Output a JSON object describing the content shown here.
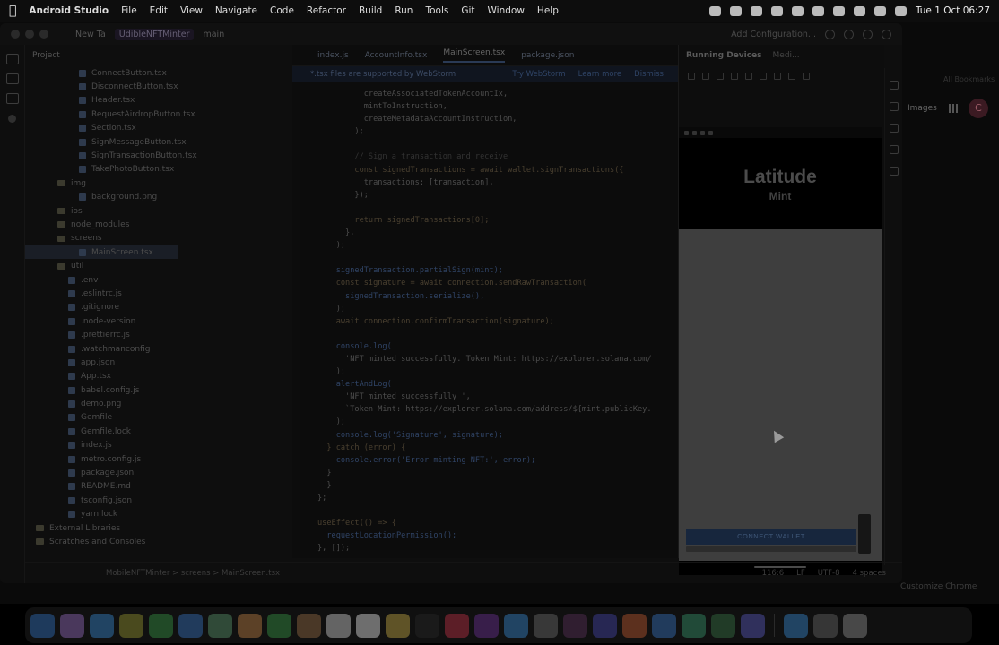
{
  "menubar": {
    "app_name": "Android Studio",
    "items": [
      "File",
      "Edit",
      "View",
      "Navigate",
      "Code",
      "Refactor",
      "Build",
      "Run",
      "Tools",
      "Git",
      "Window",
      "Help"
    ],
    "clock": "Tue 1 Oct 06:27"
  },
  "ide": {
    "top": {
      "new_tab": "New Ta",
      "project_name": "UdibleNFTMinter",
      "branch": "main",
      "run_config": "Add Configuration..."
    },
    "project_panel_title": "Project",
    "tree": [
      {
        "label": "ConnectButton.tsx",
        "kind": "file",
        "indent": 5
      },
      {
        "label": "DisconnectButton.tsx",
        "kind": "file",
        "indent": 5
      },
      {
        "label": "Header.tsx",
        "kind": "file",
        "indent": 5
      },
      {
        "label": "RequestAirdropButton.tsx",
        "kind": "file",
        "indent": 5
      },
      {
        "label": "Section.tsx",
        "kind": "file",
        "indent": 5
      },
      {
        "label": "SignMessageButton.tsx",
        "kind": "file",
        "indent": 5
      },
      {
        "label": "SignTransactionButton.tsx",
        "kind": "file",
        "indent": 5
      },
      {
        "label": "TakePhotoButton.tsx",
        "kind": "file",
        "indent": 5
      },
      {
        "label": "img",
        "kind": "dir",
        "indent": 3
      },
      {
        "label": "background.png",
        "kind": "file",
        "indent": 5
      },
      {
        "label": "ios",
        "kind": "dir",
        "indent": 3
      },
      {
        "label": "node_modules",
        "kind": "dir",
        "indent": 3
      },
      {
        "label": "screens",
        "kind": "dir",
        "indent": 3
      },
      {
        "label": "MainScreen.tsx",
        "kind": "file",
        "indent": 5,
        "selected": true
      },
      {
        "label": "util",
        "kind": "dir",
        "indent": 3
      },
      {
        "label": ".env",
        "kind": "file",
        "indent": 4
      },
      {
        "label": ".eslintrc.js",
        "kind": "file",
        "indent": 4
      },
      {
        "label": ".gitignore",
        "kind": "file",
        "indent": 4
      },
      {
        "label": ".node-version",
        "kind": "file",
        "indent": 4
      },
      {
        "label": ".prettierrc.js",
        "kind": "file",
        "indent": 4
      },
      {
        "label": ".watchmanconfig",
        "kind": "file",
        "indent": 4
      },
      {
        "label": "app.json",
        "kind": "file",
        "indent": 4
      },
      {
        "label": "App.tsx",
        "kind": "file",
        "indent": 4
      },
      {
        "label": "babel.config.js",
        "kind": "file",
        "indent": 4
      },
      {
        "label": "demo.png",
        "kind": "file",
        "indent": 4
      },
      {
        "label": "Gemfile",
        "kind": "file",
        "indent": 4
      },
      {
        "label": "Gemfile.lock",
        "kind": "file",
        "indent": 4
      },
      {
        "label": "index.js",
        "kind": "file",
        "indent": 4
      },
      {
        "label": "metro.config.js",
        "kind": "file",
        "indent": 4
      },
      {
        "label": "package.json",
        "kind": "file",
        "indent": 4
      },
      {
        "label": "README.md",
        "kind": "file",
        "indent": 4
      },
      {
        "label": "tsconfig.json",
        "kind": "file",
        "indent": 4
      },
      {
        "label": "yarn.lock",
        "kind": "file",
        "indent": 4
      },
      {
        "label": "External Libraries",
        "kind": "dir",
        "indent": 1
      },
      {
        "label": "Scratches and Consoles",
        "kind": "dir",
        "indent": 1
      }
    ],
    "tabs": [
      "index.js",
      "AccountInfo.tsx",
      "MainScreen.tsx",
      "package.json"
    ],
    "active_tab": "MainScreen.tsx",
    "banner": {
      "text": "*.tsx files are supported by WebStorm",
      "links": [
        "Try WebStorm",
        "Learn more",
        "Dismiss"
      ]
    },
    "code_lines": [
      {
        "t": "          createAssociatedTokenAccountIx,",
        "c": "tx"
      },
      {
        "t": "          mintToInstruction,",
        "c": "tx"
      },
      {
        "t": "          createMetadataAccountInstruction,",
        "c": "tx"
      },
      {
        "t": "        );",
        "c": "tx"
      },
      {
        "t": "",
        "c": "tx"
      },
      {
        "t": "        // Sign a transaction and receive",
        "c": "cm"
      },
      {
        "t": "        const signedTransactions = await wallet.signTransactions({",
        "c": "kw"
      },
      {
        "t": "          transactions: [transaction],",
        "c": "tx"
      },
      {
        "t": "        });",
        "c": "tx"
      },
      {
        "t": "",
        "c": "tx"
      },
      {
        "t": "        return signedTransactions[0];",
        "c": "kw"
      },
      {
        "t": "      },",
        "c": "tx"
      },
      {
        "t": "    );",
        "c": "tx"
      },
      {
        "t": "",
        "c": "tx"
      },
      {
        "t": "    signedTransaction.partialSign(mint);",
        "c": "fn"
      },
      {
        "t": "    const signature = await connection.sendRawTransaction(",
        "c": "kw"
      },
      {
        "t": "      signedTransaction.serialize(),",
        "c": "fn"
      },
      {
        "t": "    );",
        "c": "tx"
      },
      {
        "t": "    await connection.confirmTransaction(signature);",
        "c": "kw"
      },
      {
        "t": "",
        "c": "tx"
      },
      {
        "t": "    console.log(",
        "c": "fn"
      },
      {
        "t": "      'NFT minted successfully. Token Mint: https://explorer.solana.com/",
        "c": "tx"
      },
      {
        "t": "    );",
        "c": "tx"
      },
      {
        "t": "    alertAndLog(",
        "c": "fn"
      },
      {
        "t": "      'NFT minted successfully ',",
        "c": "tx"
      },
      {
        "t": "      `Token Mint: https://explorer.solana.com/address/${mint.publicKey.",
        "c": "tx"
      },
      {
        "t": "    );",
        "c": "tx"
      },
      {
        "t": "    console.log('Signature', signature);",
        "c": "fn"
      },
      {
        "t": "  } catch (error) {",
        "c": "kw"
      },
      {
        "t": "    console.error('Error minting NFT:', error);",
        "c": "fn"
      },
      {
        "t": "  }",
        "c": "tx"
      },
      {
        "t": "  }",
        "c": "tx"
      },
      {
        "t": "};",
        "c": "tx"
      },
      {
        "t": "",
        "c": "tx"
      },
      {
        "t": "useEffect(() => {",
        "c": "kw"
      },
      {
        "t": "  requestLocationPermission();",
        "c": "fn"
      },
      {
        "t": "}, []);",
        "c": "tx"
      }
    ],
    "status": {
      "breadcrumb": "MobileNFTMinter > screens > MainScreen.tsx",
      "position": "116:6",
      "line_sep": "LF",
      "encoding": "UTF-8",
      "indent": "4 spaces"
    }
  },
  "devices": {
    "title": "Running Devices",
    "device_tab": "Medi..."
  },
  "phone_app": {
    "title": "Latitude",
    "subtitle": "Mint",
    "connect_label": "CONNECT WALLET"
  },
  "background_window": {
    "label_all": "All Bookmarks",
    "label_images": "Images",
    "avatar_letter": "C",
    "chrome_button": "Customize Chrome"
  },
  "dock": {
    "apps": [
      {
        "name": "finder",
        "color": "#2a5c9a"
      },
      {
        "name": "launchpad",
        "color": "#7a5a9a"
      },
      {
        "name": "safari",
        "color": "#2f6fa8"
      },
      {
        "name": "chrome",
        "color": "#7a7a2a"
      },
      {
        "name": "messages",
        "color": "#2f7a3a"
      },
      {
        "name": "mail",
        "color": "#2f5f9a"
      },
      {
        "name": "maps",
        "color": "#4a7a5a"
      },
      {
        "name": "photos",
        "color": "#9a6a3a"
      },
      {
        "name": "facetime",
        "color": "#2f7a3a"
      },
      {
        "name": "contacts",
        "color": "#7a5a3a"
      },
      {
        "name": "calendar",
        "color": "#aaaaaa"
      },
      {
        "name": "reminders",
        "color": "#bbbbbb"
      },
      {
        "name": "notes",
        "color": "#a08a3a"
      },
      {
        "name": "tv",
        "color": "#222222"
      },
      {
        "name": "music",
        "color": "#9a2a3a"
      },
      {
        "name": "podcasts",
        "color": "#5a2a7a"
      },
      {
        "name": "app-store",
        "color": "#2f6fa8"
      },
      {
        "name": "settings",
        "color": "#5a5a5a"
      },
      {
        "name": "slack",
        "color": "#4a2a4a"
      },
      {
        "name": "teams",
        "color": "#3a3a8a"
      },
      {
        "name": "brave",
        "color": "#9a4a2a"
      },
      {
        "name": "vpn",
        "color": "#2f5f9a"
      },
      {
        "name": "android-studio",
        "color": "#2f7a5a"
      },
      {
        "name": "vim",
        "color": "#2f5f3a"
      },
      {
        "name": "discord",
        "color": "#4a4a9a"
      },
      {
        "name": "xcode",
        "color": "#2f6fa8"
      },
      {
        "name": "preview",
        "color": "#555555"
      },
      {
        "name": "trash",
        "color": "#777777"
      }
    ]
  }
}
